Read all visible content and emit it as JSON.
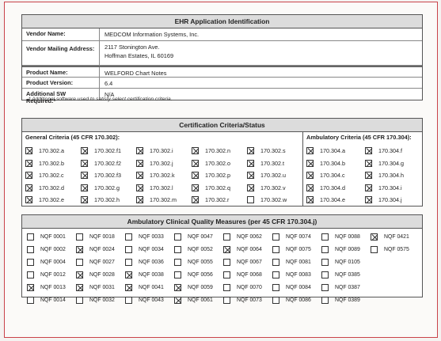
{
  "ehr": {
    "title": "EHR Application Identification",
    "vendor_name_label": "Vendor Name:",
    "vendor_name": "MEDCOM Information Systems, Inc.",
    "address_label": "Vendor Mailing Address:",
    "address_line1": "2117 Stonington Ave.",
    "address_line2": "Hoffman Estates, IL 60169",
    "product_label": "Product Name:",
    "product": "WELFORD Chart Notes",
    "version_label": "Product Version:",
    "version": "6.4",
    "addl_label": "Additional SW Required:*",
    "addl": "N/A",
    "footnote": "* Additional software used to satisfy select certification criteria."
  },
  "cert": {
    "title": "Certification Criteria/Status",
    "general_title": "General Criteria (45 CFR 170.302):",
    "ambulatory_title": "Ambulatory Criteria (45 CFR 170.304):",
    "general": [
      {
        "label": "170.302.a",
        "checked": true
      },
      {
        "label": "170.302.f1",
        "checked": true
      },
      {
        "label": "170.302.i",
        "checked": true
      },
      {
        "label": "170.302.n",
        "checked": true
      },
      {
        "label": "170.302.s",
        "checked": true
      },
      {
        "label": "170.302.b",
        "checked": true
      },
      {
        "label": "170.302.f2",
        "checked": true
      },
      {
        "label": "170.302.j",
        "checked": true
      },
      {
        "label": "170.302.o",
        "checked": true
      },
      {
        "label": "170.302.t",
        "checked": true
      },
      {
        "label": "170.302.c",
        "checked": true
      },
      {
        "label": "170.302.f3",
        "checked": true
      },
      {
        "label": "170.302.k",
        "checked": true
      },
      {
        "label": "170.302.p",
        "checked": true
      },
      {
        "label": "170.302.u",
        "checked": true
      },
      {
        "label": "170.302.d",
        "checked": true
      },
      {
        "label": "170.302.g",
        "checked": true
      },
      {
        "label": "170.302.l",
        "checked": true
      },
      {
        "label": "170.302.q",
        "checked": true
      },
      {
        "label": "170.302.v",
        "checked": true
      },
      {
        "label": "170.302.e",
        "checked": true
      },
      {
        "label": "170.302.h",
        "checked": true
      },
      {
        "label": "170.302.m",
        "checked": true
      },
      {
        "label": "170.302.r",
        "checked": true
      },
      {
        "label": "170.302.w",
        "checked": false
      }
    ],
    "ambulatory": [
      {
        "label": "170.304.a",
        "checked": true
      },
      {
        "label": "170.304.f",
        "checked": true
      },
      {
        "label": "170.304.b",
        "checked": true
      },
      {
        "label": "170.304.g",
        "checked": true
      },
      {
        "label": "170.304.c",
        "checked": true
      },
      {
        "label": "170.304.h",
        "checked": true
      },
      {
        "label": "170.304.d",
        "checked": true
      },
      {
        "label": "170.304.i",
        "checked": true
      },
      {
        "label": "170.304.e",
        "checked": true
      },
      {
        "label": "170.304.j",
        "checked": true
      }
    ]
  },
  "cqm": {
    "title": "Ambulatory Clinical Quality Measures (per 45 CFR 170.304.j)",
    "items": [
      {
        "label": "NQF 0001",
        "checked": false
      },
      {
        "label": "NQF 0018",
        "checked": false
      },
      {
        "label": "NQF 0033",
        "checked": false
      },
      {
        "label": "NQF 0047",
        "checked": false
      },
      {
        "label": "NQF 0062",
        "checked": false
      },
      {
        "label": "NQF 0074",
        "checked": false
      },
      {
        "label": "NQF 0088",
        "checked": false
      },
      {
        "label": "NQF 0421",
        "checked": true
      },
      {
        "label": "NQF 0002",
        "checked": false
      },
      {
        "label": "NQF 0024",
        "checked": true
      },
      {
        "label": "NQF 0034",
        "checked": false
      },
      {
        "label": "NQF 0052",
        "checked": false
      },
      {
        "label": "NQF 0064",
        "checked": true
      },
      {
        "label": "NQF 0075",
        "checked": false
      },
      {
        "label": "NQF 0089",
        "checked": false
      },
      {
        "label": "NQF 0575",
        "checked": false
      },
      {
        "label": "NQF 0004",
        "checked": false
      },
      {
        "label": "NQF 0027",
        "checked": false
      },
      {
        "label": "NQF 0036",
        "checked": false
      },
      {
        "label": "NQF 0055",
        "checked": false
      },
      {
        "label": "NQF 0067",
        "checked": false
      },
      {
        "label": "NQF 0081",
        "checked": false
      },
      {
        "label": "NQF 0105",
        "checked": false
      },
      null,
      {
        "label": "NQF 0012",
        "checked": false
      },
      {
        "label": "NQF 0028",
        "checked": true
      },
      {
        "label": "NQF 0038",
        "checked": true
      },
      {
        "label": "NQF 0056",
        "checked": false
      },
      {
        "label": "NQF 0068",
        "checked": false
      },
      {
        "label": "NQF 0083",
        "checked": false
      },
      {
        "label": "NQF 0385",
        "checked": false
      },
      null,
      {
        "label": "NQF 0013",
        "checked": true
      },
      {
        "label": "NQF 0031",
        "checked": true
      },
      {
        "label": "NQF 0041",
        "checked": true
      },
      {
        "label": "NQF 0059",
        "checked": true
      },
      {
        "label": "NQF 0070",
        "checked": false
      },
      {
        "label": "NQF 0084",
        "checked": false
      },
      {
        "label": "NQF 0387",
        "checked": false
      },
      null,
      {
        "label": "NQF 0014",
        "checked": false
      },
      {
        "label": "NQF 0032",
        "checked": false
      },
      {
        "label": "NQF 0043",
        "checked": false
      },
      {
        "label": "NQF 0061",
        "checked": true
      },
      {
        "label": "NQF 0073",
        "checked": false
      },
      {
        "label": "NQF 0086",
        "checked": false
      },
      {
        "label": "NQF 0389",
        "checked": false
      },
      null
    ]
  }
}
